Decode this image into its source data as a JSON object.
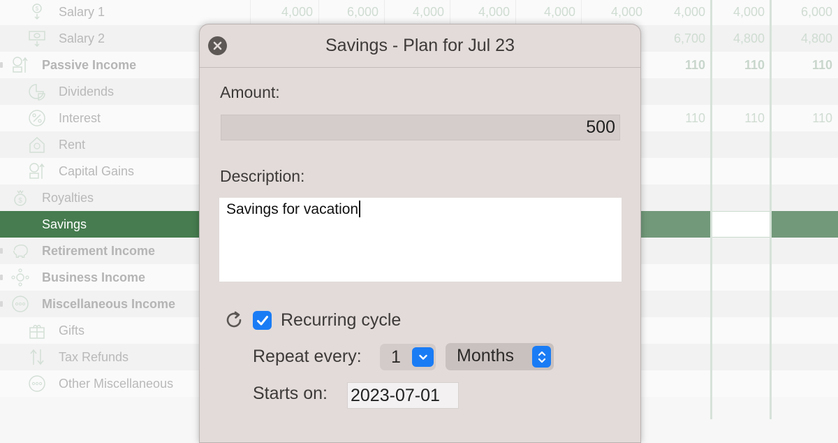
{
  "grid": {
    "rows": [
      {
        "label": "Salary 1",
        "level": 2,
        "bold": false,
        "icon": "salary-icon",
        "values": [
          "4,000",
          "6,000",
          "4,000",
          "4,000",
          "4,000",
          "4,000",
          "4,000",
          "4,000",
          "6,000"
        ]
      },
      {
        "label": "Salary 2",
        "level": 2,
        "bold": false,
        "icon": "cash-icon",
        "values": [
          "",
          "",
          "",
          "",
          "",
          "",
          "6,700",
          "4,800",
          "4,800"
        ]
      },
      {
        "label": "Passive Income",
        "level": 1,
        "bold": true,
        "icon": "passive-income-icon",
        "values": [
          "",
          "",
          "",
          "",
          "",
          "",
          "110",
          "110",
          "110"
        ]
      },
      {
        "label": "Dividends",
        "level": 2,
        "bold": false,
        "icon": "pie-chart-icon",
        "values": [
          "",
          "",
          "",
          "",
          "",
          "",
          "",
          "",
          ""
        ]
      },
      {
        "label": "Interest",
        "level": 2,
        "bold": false,
        "icon": "percent-icon",
        "values": [
          "",
          "",
          "",
          "",
          "",
          "",
          "110",
          "110",
          "110"
        ]
      },
      {
        "label": "Rent",
        "level": 2,
        "bold": false,
        "icon": "house-icon",
        "values": [
          "",
          "",
          "",
          "",
          "",
          "",
          "",
          "",
          ""
        ]
      },
      {
        "label": "Capital Gains",
        "level": 2,
        "bold": false,
        "icon": "capital-gains-icon",
        "values": [
          "",
          "",
          "",
          "",
          "",
          "",
          "",
          "",
          ""
        ]
      },
      {
        "label": "Royalties",
        "level": 1,
        "bold": false,
        "icon": "money-bag-icon",
        "values": [
          "",
          "",
          "",
          "",
          "",
          "",
          "",
          "",
          ""
        ]
      },
      {
        "label": "Savings",
        "level": 1,
        "bold": false,
        "icon": "",
        "selected": true,
        "values": [
          "",
          "",
          "",
          "",
          "",
          "",
          "",
          "",
          ""
        ]
      },
      {
        "label": "Retirement Income",
        "level": 1,
        "bold": true,
        "icon": "piggy-bank-icon",
        "values": [
          "",
          "",
          "",
          "",
          "",
          "",
          "",
          "",
          ""
        ]
      },
      {
        "label": "Business Income",
        "level": 1,
        "bold": true,
        "icon": "network-icon",
        "values": [
          "",
          "",
          "",
          "",
          "",
          "",
          "",
          "",
          ""
        ]
      },
      {
        "label": "Miscellaneous Income",
        "level": 1,
        "bold": true,
        "icon": "more-icon",
        "values": [
          "",
          "",
          "",
          "",
          "",
          "",
          "",
          "",
          ""
        ]
      },
      {
        "label": "Gifts",
        "level": 2,
        "bold": false,
        "icon": "gift-icon",
        "values": [
          "",
          "",
          "",
          "",
          "",
          "",
          "",
          "",
          ""
        ]
      },
      {
        "label": "Tax Refunds",
        "level": 2,
        "bold": false,
        "icon": "refund-arrows-icon",
        "values": [
          "",
          "",
          "",
          "",
          "",
          "",
          "",
          "",
          ""
        ]
      },
      {
        "label": "Other Miscellaneous",
        "level": 2,
        "bold": false,
        "icon": "more-icon",
        "values": [
          "",
          "",
          "",
          "",
          "",
          "",
          "",
          "",
          ""
        ]
      }
    ]
  },
  "dialog": {
    "title": "Savings - Plan for Jul 23",
    "amount_label": "Amount:",
    "amount_value": "500",
    "description_label": "Description:",
    "description_value": "Savings for vacation",
    "recurring_label": "Recurring cycle",
    "recurring_checked": true,
    "repeat_label": "Repeat every:",
    "repeat_count": "1",
    "repeat_unit": "Months",
    "starts_label": "Starts on:",
    "starts_value": "2023-07-01"
  },
  "colors": {
    "accent": "#1a7cf5",
    "selection": "#467c4f",
    "selection_light": "#72997a"
  }
}
